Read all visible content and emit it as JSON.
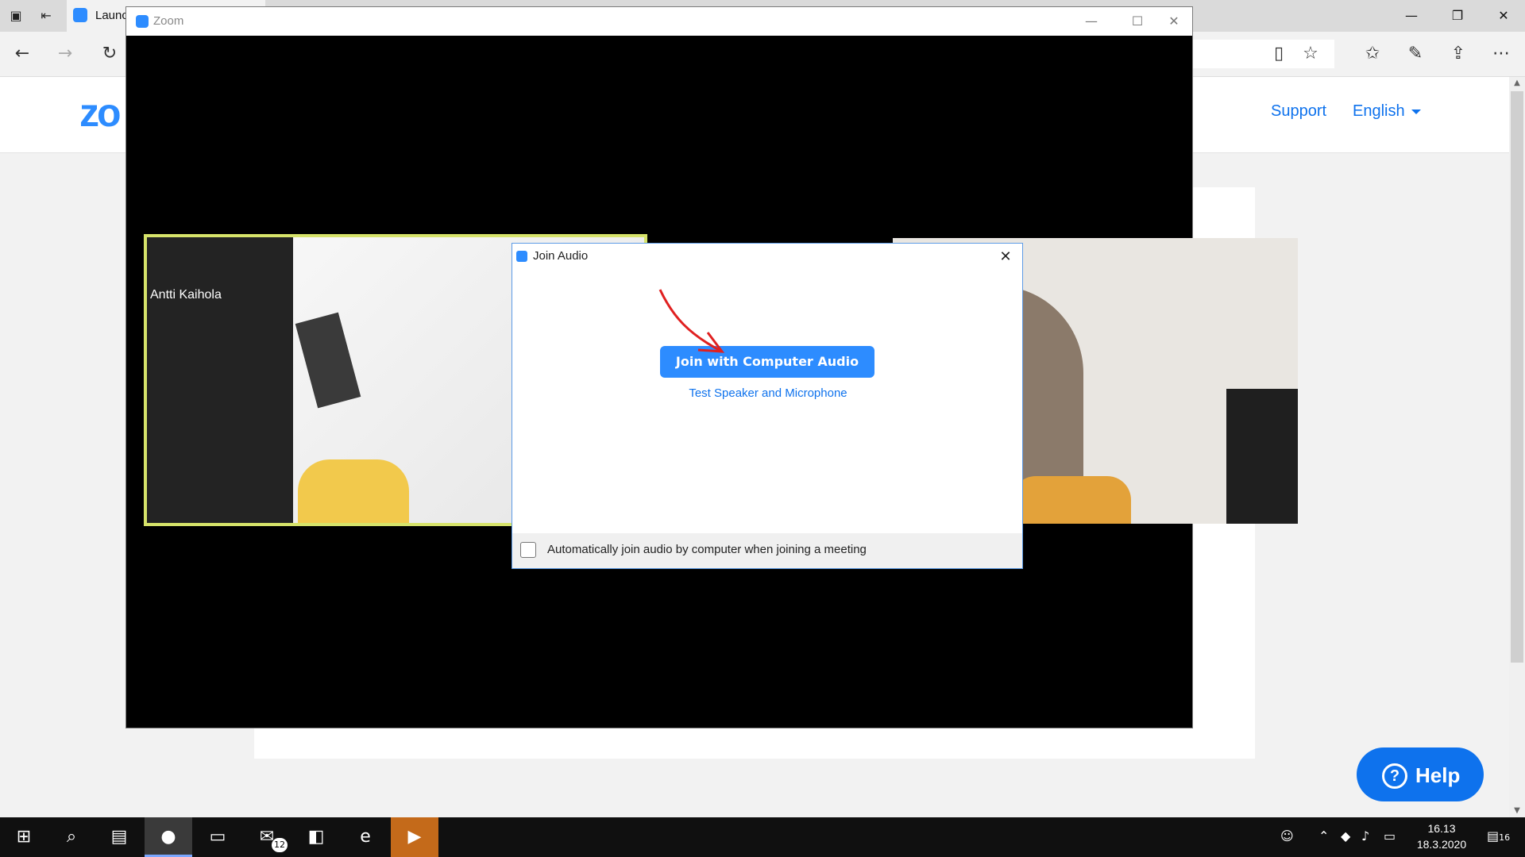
{
  "browser": {
    "tab_title": "Launch Meeting - Zoom",
    "page": {
      "logo_text": "zo",
      "nav_support": "Support",
      "nav_language": "English",
      "help_label": "Help"
    }
  },
  "zoom_window": {
    "title": "Zoom",
    "participant_name": "Antti Kaihola"
  },
  "join_audio_dialog": {
    "title": "Join Audio",
    "join_button": "Join with Computer Audio",
    "test_link": "Test Speaker and Microphone",
    "checkbox_label": "Automatically join audio by computer when joining a meeting",
    "checkbox_checked": false
  },
  "taskbar": {
    "mail_badge": "12",
    "time": "16.13",
    "date": "18.3.2020",
    "notification_count": "16"
  },
  "colors": {
    "zoom_blue": "#2d8cff",
    "link_blue": "#0e72ed",
    "active_speaker_border": "#d6e36a"
  }
}
